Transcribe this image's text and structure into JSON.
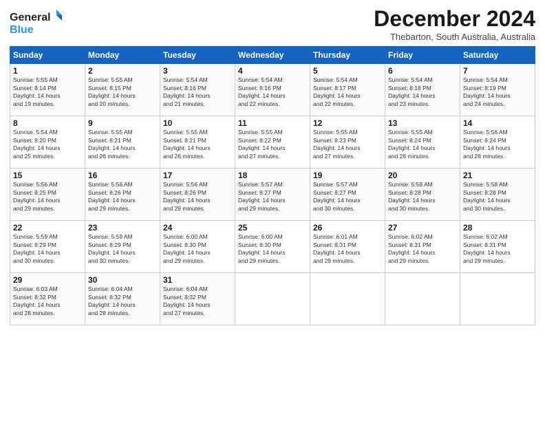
{
  "logo": {
    "line1": "General",
    "line2": "Blue"
  },
  "title": "December 2024",
  "subtitle": "Thebarton, South Australia, Australia",
  "days_header": [
    "Sunday",
    "Monday",
    "Tuesday",
    "Wednesday",
    "Thursday",
    "Friday",
    "Saturday"
  ],
  "weeks": [
    [
      {
        "num": "1",
        "rise": "5:55 AM",
        "set": "8:14 PM",
        "daylight": "14 hours and 19 minutes."
      },
      {
        "num": "2",
        "rise": "5:55 AM",
        "set": "8:15 PM",
        "daylight": "14 hours and 20 minutes."
      },
      {
        "num": "3",
        "rise": "5:54 AM",
        "set": "8:16 PM",
        "daylight": "14 hours and 21 minutes."
      },
      {
        "num": "4",
        "rise": "5:54 AM",
        "set": "8:16 PM",
        "daylight": "14 hours and 22 minutes."
      },
      {
        "num": "5",
        "rise": "5:54 AM",
        "set": "8:17 PM",
        "daylight": "14 hours and 22 minutes."
      },
      {
        "num": "6",
        "rise": "5:54 AM",
        "set": "8:18 PM",
        "daylight": "14 hours and 23 minutes."
      },
      {
        "num": "7",
        "rise": "5:54 AM",
        "set": "8:19 PM",
        "daylight": "14 hours and 24 minutes."
      }
    ],
    [
      {
        "num": "8",
        "rise": "5:54 AM",
        "set": "8:20 PM",
        "daylight": "14 hours and 25 minutes."
      },
      {
        "num": "9",
        "rise": "5:55 AM",
        "set": "8:21 PM",
        "daylight": "14 hours and 26 minutes."
      },
      {
        "num": "10",
        "rise": "5:55 AM",
        "set": "8:21 PM",
        "daylight": "14 hours and 26 minutes."
      },
      {
        "num": "11",
        "rise": "5:55 AM",
        "set": "8:22 PM",
        "daylight": "14 hours and 27 minutes."
      },
      {
        "num": "12",
        "rise": "5:55 AM",
        "set": "8:23 PM",
        "daylight": "14 hours and 27 minutes."
      },
      {
        "num": "13",
        "rise": "5:55 AM",
        "set": "8:24 PM",
        "daylight": "14 hours and 28 minutes."
      },
      {
        "num": "14",
        "rise": "5:56 AM",
        "set": "8:24 PM",
        "daylight": "14 hours and 28 minutes."
      }
    ],
    [
      {
        "num": "15",
        "rise": "5:56 AM",
        "set": "8:25 PM",
        "daylight": "14 hours and 29 minutes."
      },
      {
        "num": "16",
        "rise": "5:56 AM",
        "set": "8:26 PM",
        "daylight": "14 hours and 29 minutes."
      },
      {
        "num": "17",
        "rise": "5:56 AM",
        "set": "8:26 PM",
        "daylight": "14 hours and 29 minutes."
      },
      {
        "num": "18",
        "rise": "5:57 AM",
        "set": "8:27 PM",
        "daylight": "14 hours and 29 minutes."
      },
      {
        "num": "19",
        "rise": "5:57 AM",
        "set": "8:27 PM",
        "daylight": "14 hours and 30 minutes."
      },
      {
        "num": "20",
        "rise": "5:58 AM",
        "set": "8:28 PM",
        "daylight": "14 hours and 30 minutes."
      },
      {
        "num": "21",
        "rise": "5:58 AM",
        "set": "8:28 PM",
        "daylight": "14 hours and 30 minutes."
      }
    ],
    [
      {
        "num": "22",
        "rise": "5:59 AM",
        "set": "8:29 PM",
        "daylight": "14 hours and 30 minutes."
      },
      {
        "num": "23",
        "rise": "5:59 AM",
        "set": "8:29 PM",
        "daylight": "14 hours and 30 minutes."
      },
      {
        "num": "24",
        "rise": "6:00 AM",
        "set": "8:30 PM",
        "daylight": "14 hours and 29 minutes."
      },
      {
        "num": "25",
        "rise": "6:00 AM",
        "set": "8:30 PM",
        "daylight": "14 hours and 29 minutes."
      },
      {
        "num": "26",
        "rise": "6:01 AM",
        "set": "8:31 PM",
        "daylight": "14 hours and 29 minutes."
      },
      {
        "num": "27",
        "rise": "6:02 AM",
        "set": "8:31 PM",
        "daylight": "14 hours and 29 minutes."
      },
      {
        "num": "28",
        "rise": "6:02 AM",
        "set": "8:31 PM",
        "daylight": "14 hours and 29 minutes."
      }
    ],
    [
      {
        "num": "29",
        "rise": "6:03 AM",
        "set": "8:32 PM",
        "daylight": "14 hours and 28 minutes."
      },
      {
        "num": "30",
        "rise": "6:04 AM",
        "set": "8:32 PM",
        "daylight": "14 hours and 28 minutes."
      },
      {
        "num": "31",
        "rise": "6:04 AM",
        "set": "8:32 PM",
        "daylight": "14 hours and 27 minutes."
      },
      null,
      null,
      null,
      null
    ]
  ],
  "labels": {
    "sunrise": "Sunrise:",
    "sunset": "Sunset:",
    "daylight": "Daylight:"
  }
}
